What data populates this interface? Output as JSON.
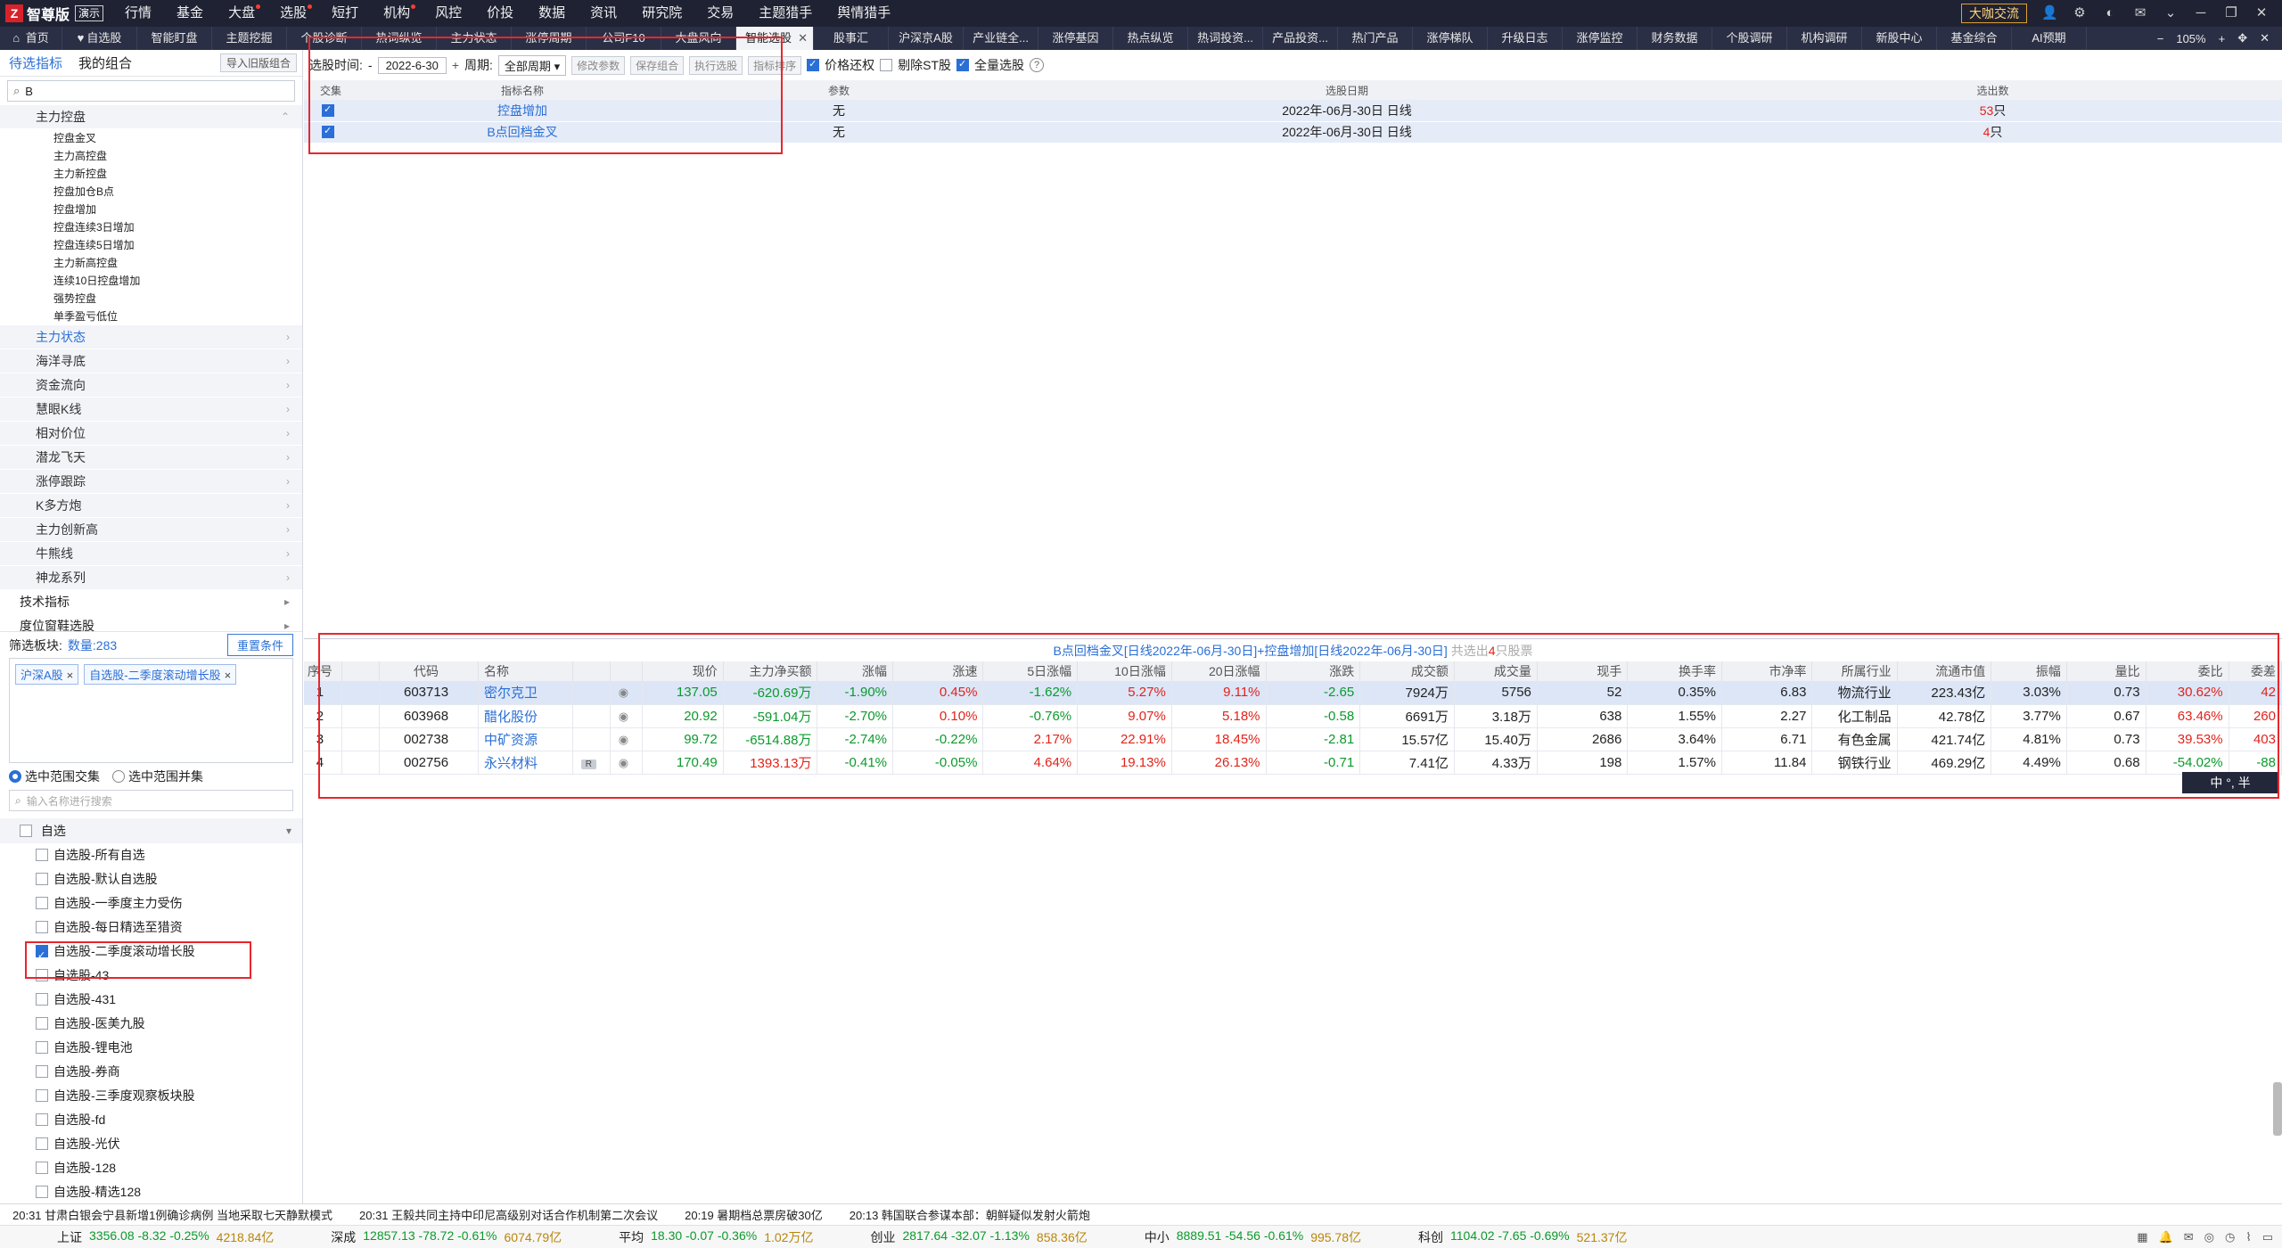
{
  "app": {
    "brand": "智尊版",
    "demo": "演示",
    "exchange": "大咖交流"
  },
  "menu": [
    {
      "label": "行情",
      "dot": false
    },
    {
      "label": "基金",
      "dot": false
    },
    {
      "label": "大盘",
      "dot": true
    },
    {
      "label": "选股",
      "dot": true
    },
    {
      "label": "短打",
      "dot": false
    },
    {
      "label": "机构",
      "dot": true
    },
    {
      "label": "风控",
      "dot": false
    },
    {
      "label": "价投",
      "dot": false
    },
    {
      "label": "数据",
      "dot": false
    },
    {
      "label": "资讯",
      "dot": false
    },
    {
      "label": "研究院",
      "dot": false
    },
    {
      "label": "交易",
      "dot": false
    },
    {
      "label": "主题猎手",
      "dot": false
    },
    {
      "label": "舆情猎手",
      "dot": false
    }
  ],
  "tabs": [
    {
      "label": "首页"
    },
    {
      "label": "自选股"
    },
    {
      "label": "智能盯盘"
    },
    {
      "label": "主题挖掘"
    },
    {
      "label": "个股诊断"
    },
    {
      "label": "热词纵览"
    },
    {
      "label": "主力状态"
    },
    {
      "label": "涨停周期"
    },
    {
      "label": "公司F10"
    },
    {
      "label": "大盘风向"
    },
    {
      "label": "智能选股",
      "active": true
    },
    {
      "label": "股事汇"
    },
    {
      "label": "沪深京A股"
    },
    {
      "label": "产业链全..."
    },
    {
      "label": "涨停基因"
    },
    {
      "label": "热点纵览"
    },
    {
      "label": "热词投资..."
    },
    {
      "label": "产品投资..."
    },
    {
      "label": "热门产品"
    },
    {
      "label": "涨停梯队"
    },
    {
      "label": "升级日志"
    },
    {
      "label": "涨停监控"
    },
    {
      "label": "财务数据"
    },
    {
      "label": "个股调研"
    },
    {
      "label": "机构调研"
    },
    {
      "label": "新股中心"
    },
    {
      "label": "基金综合"
    },
    {
      "label": "AI预期"
    }
  ],
  "zoom": "105%",
  "left": {
    "tab_active": "待选指标",
    "tab_other": "我的组合",
    "import_btn": "导入旧版组合",
    "search_value": "B",
    "group_open": "主力控盘",
    "leaves": [
      "控盘金叉",
      "主力高控盘",
      "主力新控盘",
      "控盘加仓B点",
      "控盘增加",
      "控盘连续3日增加",
      "控盘连续5日增加",
      "主力新高控盘",
      "连续10日控盘增加",
      "强势控盘",
      "单季盈亏低位"
    ],
    "groups": [
      "主力状态",
      "海洋寻底",
      "资金流向",
      "慧眼K线",
      "相对价位",
      "潜龙飞天",
      "涨停跟踪",
      "K多方炮",
      "主力创新高",
      "牛熊线",
      "神龙系列"
    ],
    "tops": [
      "技术指标",
      "度位窗鞋选股"
    ],
    "filter_label": "筛选板块:",
    "filter_count": "数量:283",
    "reset": "重置条件",
    "chips": [
      "沪深A股",
      "自选股-二季度滚动增长股"
    ],
    "radio_intersect": "选中范围交集",
    "radio_union": "选中范围并集",
    "name_search_placeholder": "输入名称进行搜索",
    "watch_head": "自选",
    "watch_items": [
      {
        "label": "自选股-所有自选",
        "checked": false
      },
      {
        "label": "自选股-默认自选股",
        "checked": false
      },
      {
        "label": "自选股-一季度主力受伤",
        "checked": false
      },
      {
        "label": "自选股-每日精选至猎资",
        "checked": false
      },
      {
        "label": "自选股-二季度滚动增长股",
        "checked": true
      },
      {
        "label": "自选股-43",
        "checked": false
      },
      {
        "label": "自选股-431",
        "checked": false
      },
      {
        "label": "自选股-医美九股",
        "checked": false
      },
      {
        "label": "自选股-锂电池",
        "checked": false
      },
      {
        "label": "自选股-券商",
        "checked": false
      },
      {
        "label": "自选股-三季度观察板块股",
        "checked": false
      },
      {
        "label": "自选股-fd",
        "checked": false
      },
      {
        "label": "自选股-光伏",
        "checked": false
      },
      {
        "label": "自选股-128",
        "checked": false
      },
      {
        "label": "自选股-精选128",
        "checked": false
      }
    ]
  },
  "toolbar": {
    "time_label": "选股时间:",
    "dash": "-",
    "date": "2022-6-30",
    "plus": "+",
    "period_label": "周期:",
    "period": "全部周期",
    "btn_params": "修改参数",
    "btn_save": "保存组合",
    "btn_run": "执行选股",
    "btn_sort": "指标排序",
    "opt_price": "价格还权",
    "opt_st": "剔除ST股",
    "opt_all": "全量选股"
  },
  "criteria": {
    "headers": [
      "交集",
      "指标名称",
      "参数",
      "选股日期",
      "选出数"
    ],
    "rows": [
      {
        "name": "控盘增加",
        "param": "无",
        "date": "2022年-06月-30日 日线",
        "count": "53",
        "unit": "只"
      },
      {
        "name": "B点回档金叉",
        "param": "无",
        "date": "2022年-06月-30日 日线",
        "count": "4",
        "unit": "只"
      }
    ]
  },
  "result": {
    "title": "B点回档金叉[日线2022年-06月-30日]+控盘增加[日线2022年-06月-30日]",
    "pre": "共选出",
    "count": "4",
    "post": "只股票",
    "headers": [
      "序号",
      "代码",
      "名称",
      "现价",
      "主力净买额",
      "涨幅",
      "涨速",
      "5日涨幅",
      "10日涨幅",
      "20日涨幅",
      "涨跌",
      "成交额",
      "成交量",
      "现手",
      "换手率",
      "市净率",
      "所属行业",
      "流通市值",
      "振幅",
      "量比",
      "委比",
      "委差"
    ],
    "rows": [
      [
        "1",
        "603713",
        "密尔克卫",
        "",
        "137.05",
        "-620.69万",
        "-1.90%",
        "0.45%",
        "-1.62%",
        "5.27%",
        "9.11%",
        "-2.65",
        "7924万",
        "5756",
        "52",
        "0.35%",
        "6.83",
        "物流行业",
        "223.43亿",
        "3.03%",
        "0.73",
        "30.62%",
        "42"
      ],
      [
        "2",
        "603968",
        "醋化股份",
        "",
        "20.92",
        "-591.04万",
        "-2.70%",
        "0.10%",
        "-0.76%",
        "9.07%",
        "5.18%",
        "-0.58",
        "6691万",
        "3.18万",
        "638",
        "1.55%",
        "2.27",
        "化工制品",
        "42.78亿",
        "3.77%",
        "0.67",
        "63.46%",
        "260"
      ],
      [
        "3",
        "002738",
        "中矿资源",
        "",
        "99.72",
        "-6514.88万",
        "-2.74%",
        "-0.22%",
        "2.17%",
        "22.91%",
        "18.45%",
        "-2.81",
        "15.57亿",
        "15.40万",
        "2686",
        "3.64%",
        "6.71",
        "有色金属",
        "421.74亿",
        "4.81%",
        "0.73",
        "39.53%",
        "403"
      ],
      [
        "4",
        "002756",
        "永兴材料",
        "R",
        "170.49",
        "1393.13万",
        "-0.41%",
        "-0.05%",
        "4.64%",
        "19.13%",
        "26.13%",
        "-0.71",
        "7.41亿",
        "4.33万",
        "198",
        "1.57%",
        "11.84",
        "钢铁行业",
        "469.29亿",
        "4.49%",
        "0.68",
        "-54.02%",
        "-88"
      ]
    ]
  },
  "ime": "中 °, 半",
  "news": [
    "20:31 甘肃白银会宁县新增1例确诊病例 当地采取七天静默模式",
    "20:31 王毅共同主持中印尼高级别对话合作机制第二次会议",
    "20:19 暑期档总票房破30亿",
    "20:13 韩国联合参谋本部：朝鲜疑似发射火箭炮"
  ],
  "ticker": [
    {
      "name": "上证",
      "val": "3356.08 -8.32 -0.25%",
      "amt": "4218.84亿",
      "up": false
    },
    {
      "name": "深成",
      "val": "12857.13 -78.72 -0.61%",
      "amt": "6074.79亿",
      "up": false
    },
    {
      "name": "平均",
      "val": "18.30 -0.07 -0.36%",
      "amt": "1.02万亿",
      "up": false
    },
    {
      "name": "创业",
      "val": "2817.64 -32.07 -1.13%",
      "amt": "858.36亿",
      "up": false
    },
    {
      "name": "中小",
      "val": "8889.51 -54.56 -0.61%",
      "amt": "995.78亿",
      "up": false
    },
    {
      "name": "科创",
      "val": "1104.02 -7.65 -0.69%",
      "amt": "521.37亿",
      "up": false
    }
  ]
}
